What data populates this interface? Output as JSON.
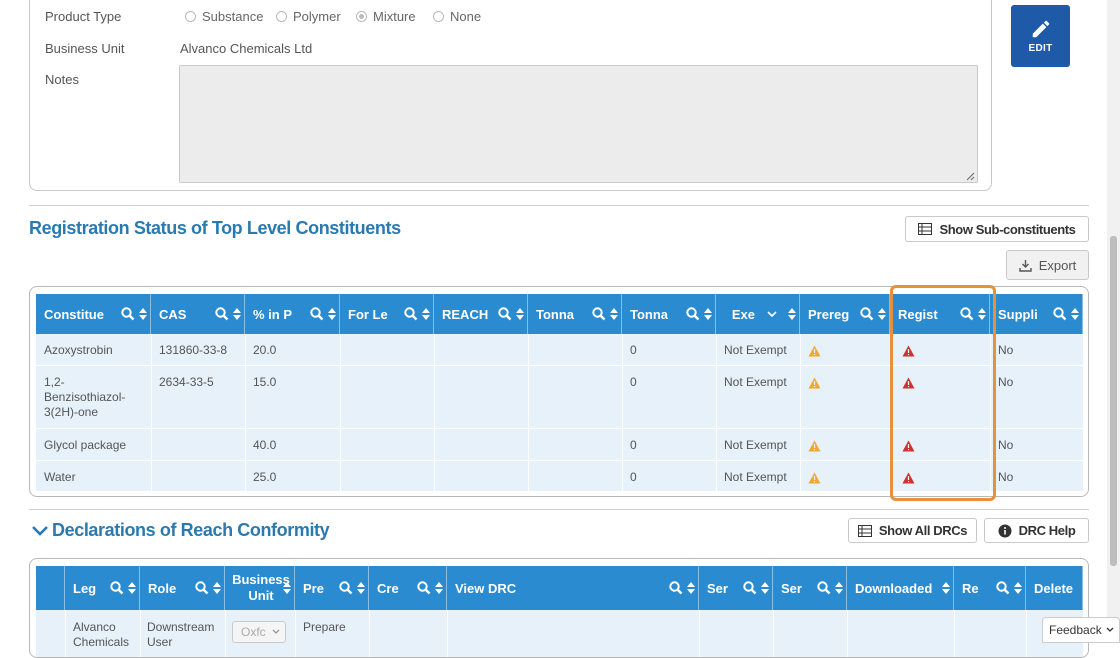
{
  "product_form": {
    "product_type_label": "Product Type",
    "product_type_options": [
      "Substance",
      "Polymer",
      "Mixture",
      "None"
    ],
    "product_type_selected": "Mixture",
    "business_unit_label": "Business Unit",
    "business_unit_value": "Alvanco Chemicals Ltd",
    "notes_label": "Notes",
    "notes_value": ""
  },
  "edit_button": {
    "label": "EDIT",
    "icon": "pencil-icon"
  },
  "registration": {
    "title": "Registration Status of Top Level Constituents",
    "show_sub_label": "Show Sub-constituents",
    "export_label": "Export",
    "columns": [
      "Constitue",
      "CAS",
      "% in P",
      "For Le",
      "REACH",
      "Tonna",
      "Tonna",
      "Exe",
      "Prereg",
      "Regist",
      "Suppli"
    ],
    "rows": [
      {
        "constituent": "Azoxystrobin",
        "cas": "131860-33-8",
        "pct": "20.0",
        "for_le": "",
        "reach": "",
        "tonna1": "",
        "tonna2": "0",
        "exempt": "Not Exempt",
        "prereg": "warning",
        "regist": "error",
        "supplier": "No"
      },
      {
        "constituent": "1,2-Benzisothiazol-3(2H)-one",
        "cas": "2634-33-5",
        "pct": "15.0",
        "for_le": "",
        "reach": "",
        "tonna1": "",
        "tonna2": "0",
        "exempt": "Not Exempt",
        "prereg": "warning",
        "regist": "error",
        "supplier": "No"
      },
      {
        "constituent": "Glycol package",
        "cas": "",
        "pct": "40.0",
        "for_le": "",
        "reach": "",
        "tonna1": "",
        "tonna2": "0",
        "exempt": "Not Exempt",
        "prereg": "warning",
        "regist": "error",
        "supplier": "No"
      },
      {
        "constituent": "Water",
        "cas": "",
        "pct": "25.0",
        "for_le": "",
        "reach": "",
        "tonna1": "",
        "tonna2": "0",
        "exempt": "Not Exempt",
        "prereg": "warning",
        "regist": "error",
        "supplier": "No"
      }
    ],
    "constituent_lines": [
      [
        "Azoxystrobin"
      ],
      [
        "1,2-",
        "Benzisothiazol-",
        "3(2H)-one"
      ],
      [
        "Glycol package"
      ],
      [
        "Water"
      ]
    ]
  },
  "declarations": {
    "title": "Declarations of Reach Conformity",
    "show_all_label": "Show All DRCs",
    "help_label": "DRC Help",
    "columns": [
      "Leg",
      "Role",
      "Business Unit",
      "Pre",
      "Cre",
      "View DRC",
      "Ser",
      "Ser",
      "Downloaded",
      "Re",
      "Delete"
    ],
    "business_unit_lines": [
      "Business",
      "Unit"
    ],
    "first_row": {
      "entity_lines": [
        "Alvanco",
        "Chemicals"
      ],
      "role_lines": [
        "Downstream",
        "User"
      ],
      "bu_select": "Oxfc",
      "prepare": "Prepare"
    }
  },
  "feedback_label": "Feedback",
  "colors": {
    "header_blue": "#2a8bd0",
    "row_bg": "#e6f1f9",
    "title_blue": "#2a7ab0",
    "edit_blue": "#1e5aa8",
    "highlight": "#e8913a",
    "warning": "#f0a830",
    "error": "#d32f2f"
  }
}
